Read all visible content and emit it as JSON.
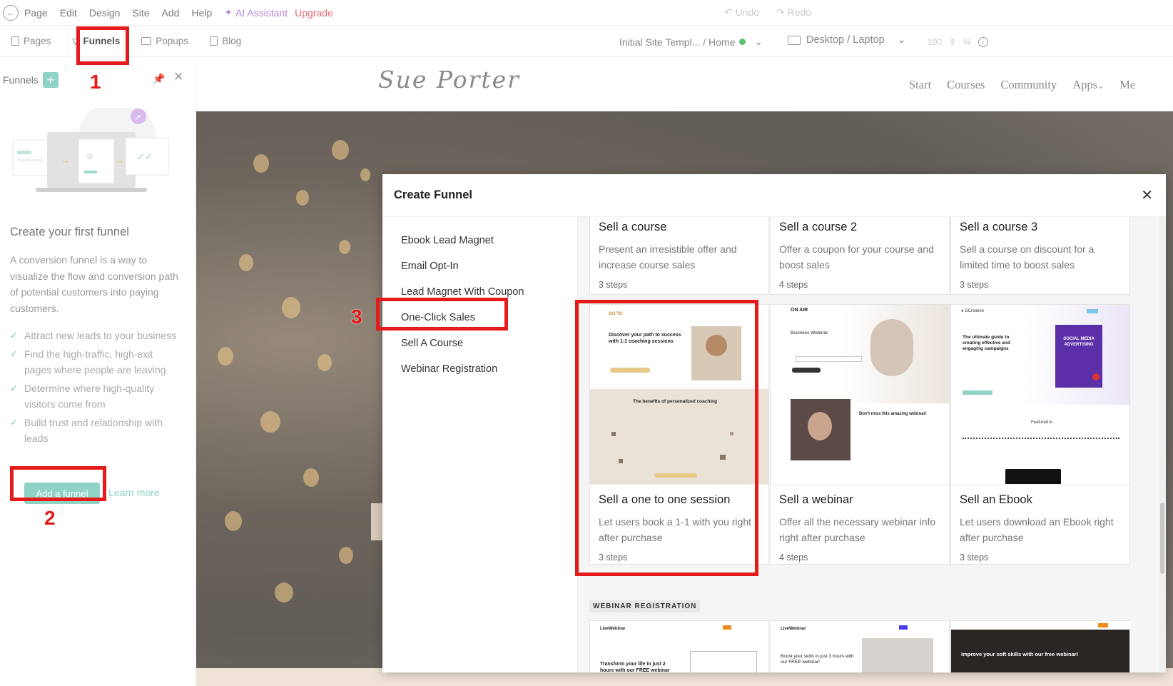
{
  "topbar": {
    "menu": [
      "Page",
      "Edit",
      "Design",
      "Site",
      "Add",
      "Help"
    ],
    "ai_label": "AI Assistant",
    "upgrade_label": "Upgrade",
    "undo_label": "Undo",
    "redo_label": "Redo"
  },
  "tabs": [
    "Pages",
    "Funnels",
    "Popups",
    "Blog"
  ],
  "site_path": "Initial Site Templ... / Home",
  "device_label": "Desktop / Laptop",
  "zoom": {
    "value": "100",
    "unit": "%"
  },
  "left_panel": {
    "title": "Funnels",
    "heading": "Create your first funnel",
    "description": "A conversion funnel is a way to visualize the flow and conversion path of potential customers into paying customers.",
    "bullets": [
      "Attract new leads to your business",
      "Find the high-traffic, high-exit pages where people are leaving",
      "Determine where high-quality visitors come from",
      "Build trust and relationship with leads"
    ],
    "add_button": "Add a funnel",
    "learn_more": "Learn more"
  },
  "site": {
    "logo": "Sue Porter",
    "nav": [
      "Start",
      "Courses",
      "Community",
      "Apps",
      "Me"
    ]
  },
  "modal": {
    "title": "Create Funnel",
    "categories": [
      "Ebook Lead Magnet",
      "Email Opt-In",
      "Lead Magnet With Coupon",
      "One-Click Sales",
      "Sell A Course",
      "Webinar Registration"
    ],
    "cards": [
      {
        "title": "Sell a course",
        "desc": "Present an irresistible offer and increase course sales",
        "steps": "3 steps"
      },
      {
        "title": "Sell a course 2",
        "desc": "Offer a coupon for your course and boost sales",
        "steps": "4 steps"
      },
      {
        "title": "Sell a course 3",
        "desc": "Sell a course on discount for a limited time to boost sales",
        "steps": "3 steps"
      },
      {
        "title": "Sell a one to one session",
        "desc": "Let users book a 1-1 with you right after purchase",
        "steps": "3 steps"
      },
      {
        "title": "Sell a webinar",
        "desc": "Offer all the necessary webinar info right after purchase",
        "steps": "4 steps"
      },
      {
        "title": "Sell an Ebook",
        "desc": "Let users download an Ebook right after purchase",
        "steps": "3 steps"
      }
    ],
    "section_label": "WEBINAR REGISTRATION",
    "thumb_texts": {
      "coaching_heading": "Discover your path to success with 1:1 coaching sessions",
      "coaching_benefits": "The benefits of personalized coaching",
      "webinar_brand": "ON AIR",
      "webinar_heading": "Business Webinar",
      "webinar_miss": "Don't miss this amazing webinar!",
      "ebook_heading": "The ultimate guide to creating effective and engaging campaigns",
      "ebook_cover": "SOCIAL MEDIA ADVERTISING",
      "ebook_featured": "Featured in",
      "w1_brand": "LiveWebinar",
      "w1_heading": "Transform your life in just 2 hours with our FREE webinar",
      "w2_heading": "Boost your skills in just 3 hours with our FREE webinar!",
      "w3_heading": "Improve your soft skills with our free webinar!"
    }
  },
  "annotations": [
    "1",
    "2",
    "3"
  ]
}
